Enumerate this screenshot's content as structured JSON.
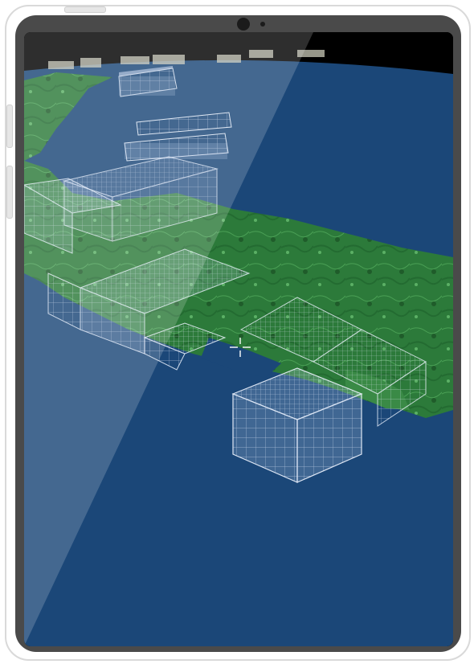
{
  "device": {
    "type": "tablet",
    "frame_color": "#4a4a4a",
    "bezel_color": "#ffffff"
  },
  "scene": {
    "view": "3D globe",
    "ocean_color": "#1b4778",
    "land_color": "#2f7d3c",
    "grid_color": "#dde9ff",
    "crosshair_icon": "crosshair-icon"
  }
}
